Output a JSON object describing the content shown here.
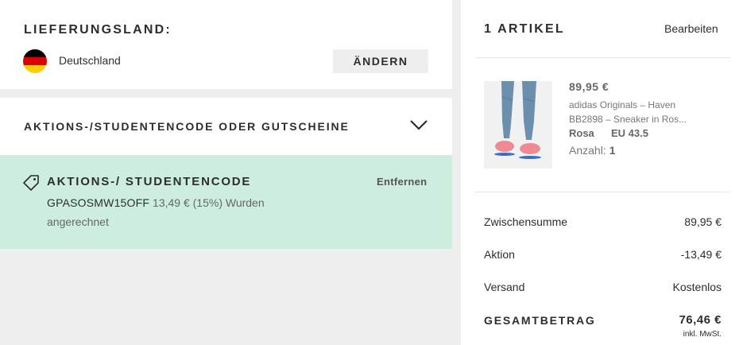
{
  "delivery": {
    "title": "LIEFERUNGSLAND:",
    "country": "Deutschland",
    "flag_icon": "germany-flag-icon",
    "change_label": "ÄNDERN"
  },
  "promo": {
    "title": "AKTIONS-/STUDENTENCODE ODER GUTSCHEINE",
    "chevron_icon": "chevron-down-icon"
  },
  "applied_code": {
    "tag_icon": "tag-icon",
    "title": "AKTIONS-/ STUDENTENCODE",
    "remove_label": "Entfernen",
    "code": "GPASOSMW15OFF",
    "discount_text": " 13,49 € (15%) Wurden",
    "discount_text_2": "angerechnet",
    "background_color": "#cdeede"
  },
  "bag": {
    "title": "1 ARTIKEL",
    "edit_label": "Bearbeiten",
    "items": [
      {
        "price": "89,95 €",
        "name": "adidas Originals – Haven BB2898 – Sneaker in Ros...",
        "color": "Rosa",
        "size": "EU 43.5",
        "qty_label": "Anzahl:",
        "qty": "1"
      }
    ]
  },
  "summary": {
    "subtotal_label": "Zwischensumme",
    "subtotal_value": "89,95 €",
    "promo_label": "Aktion",
    "promo_value": "-13,49 €",
    "shipping_label": "Versand",
    "shipping_value": "Kostenlos",
    "total_label": "GESAMTBETRAG",
    "total_value": "76,46 €",
    "vat_note": "inkl. MwSt."
  }
}
